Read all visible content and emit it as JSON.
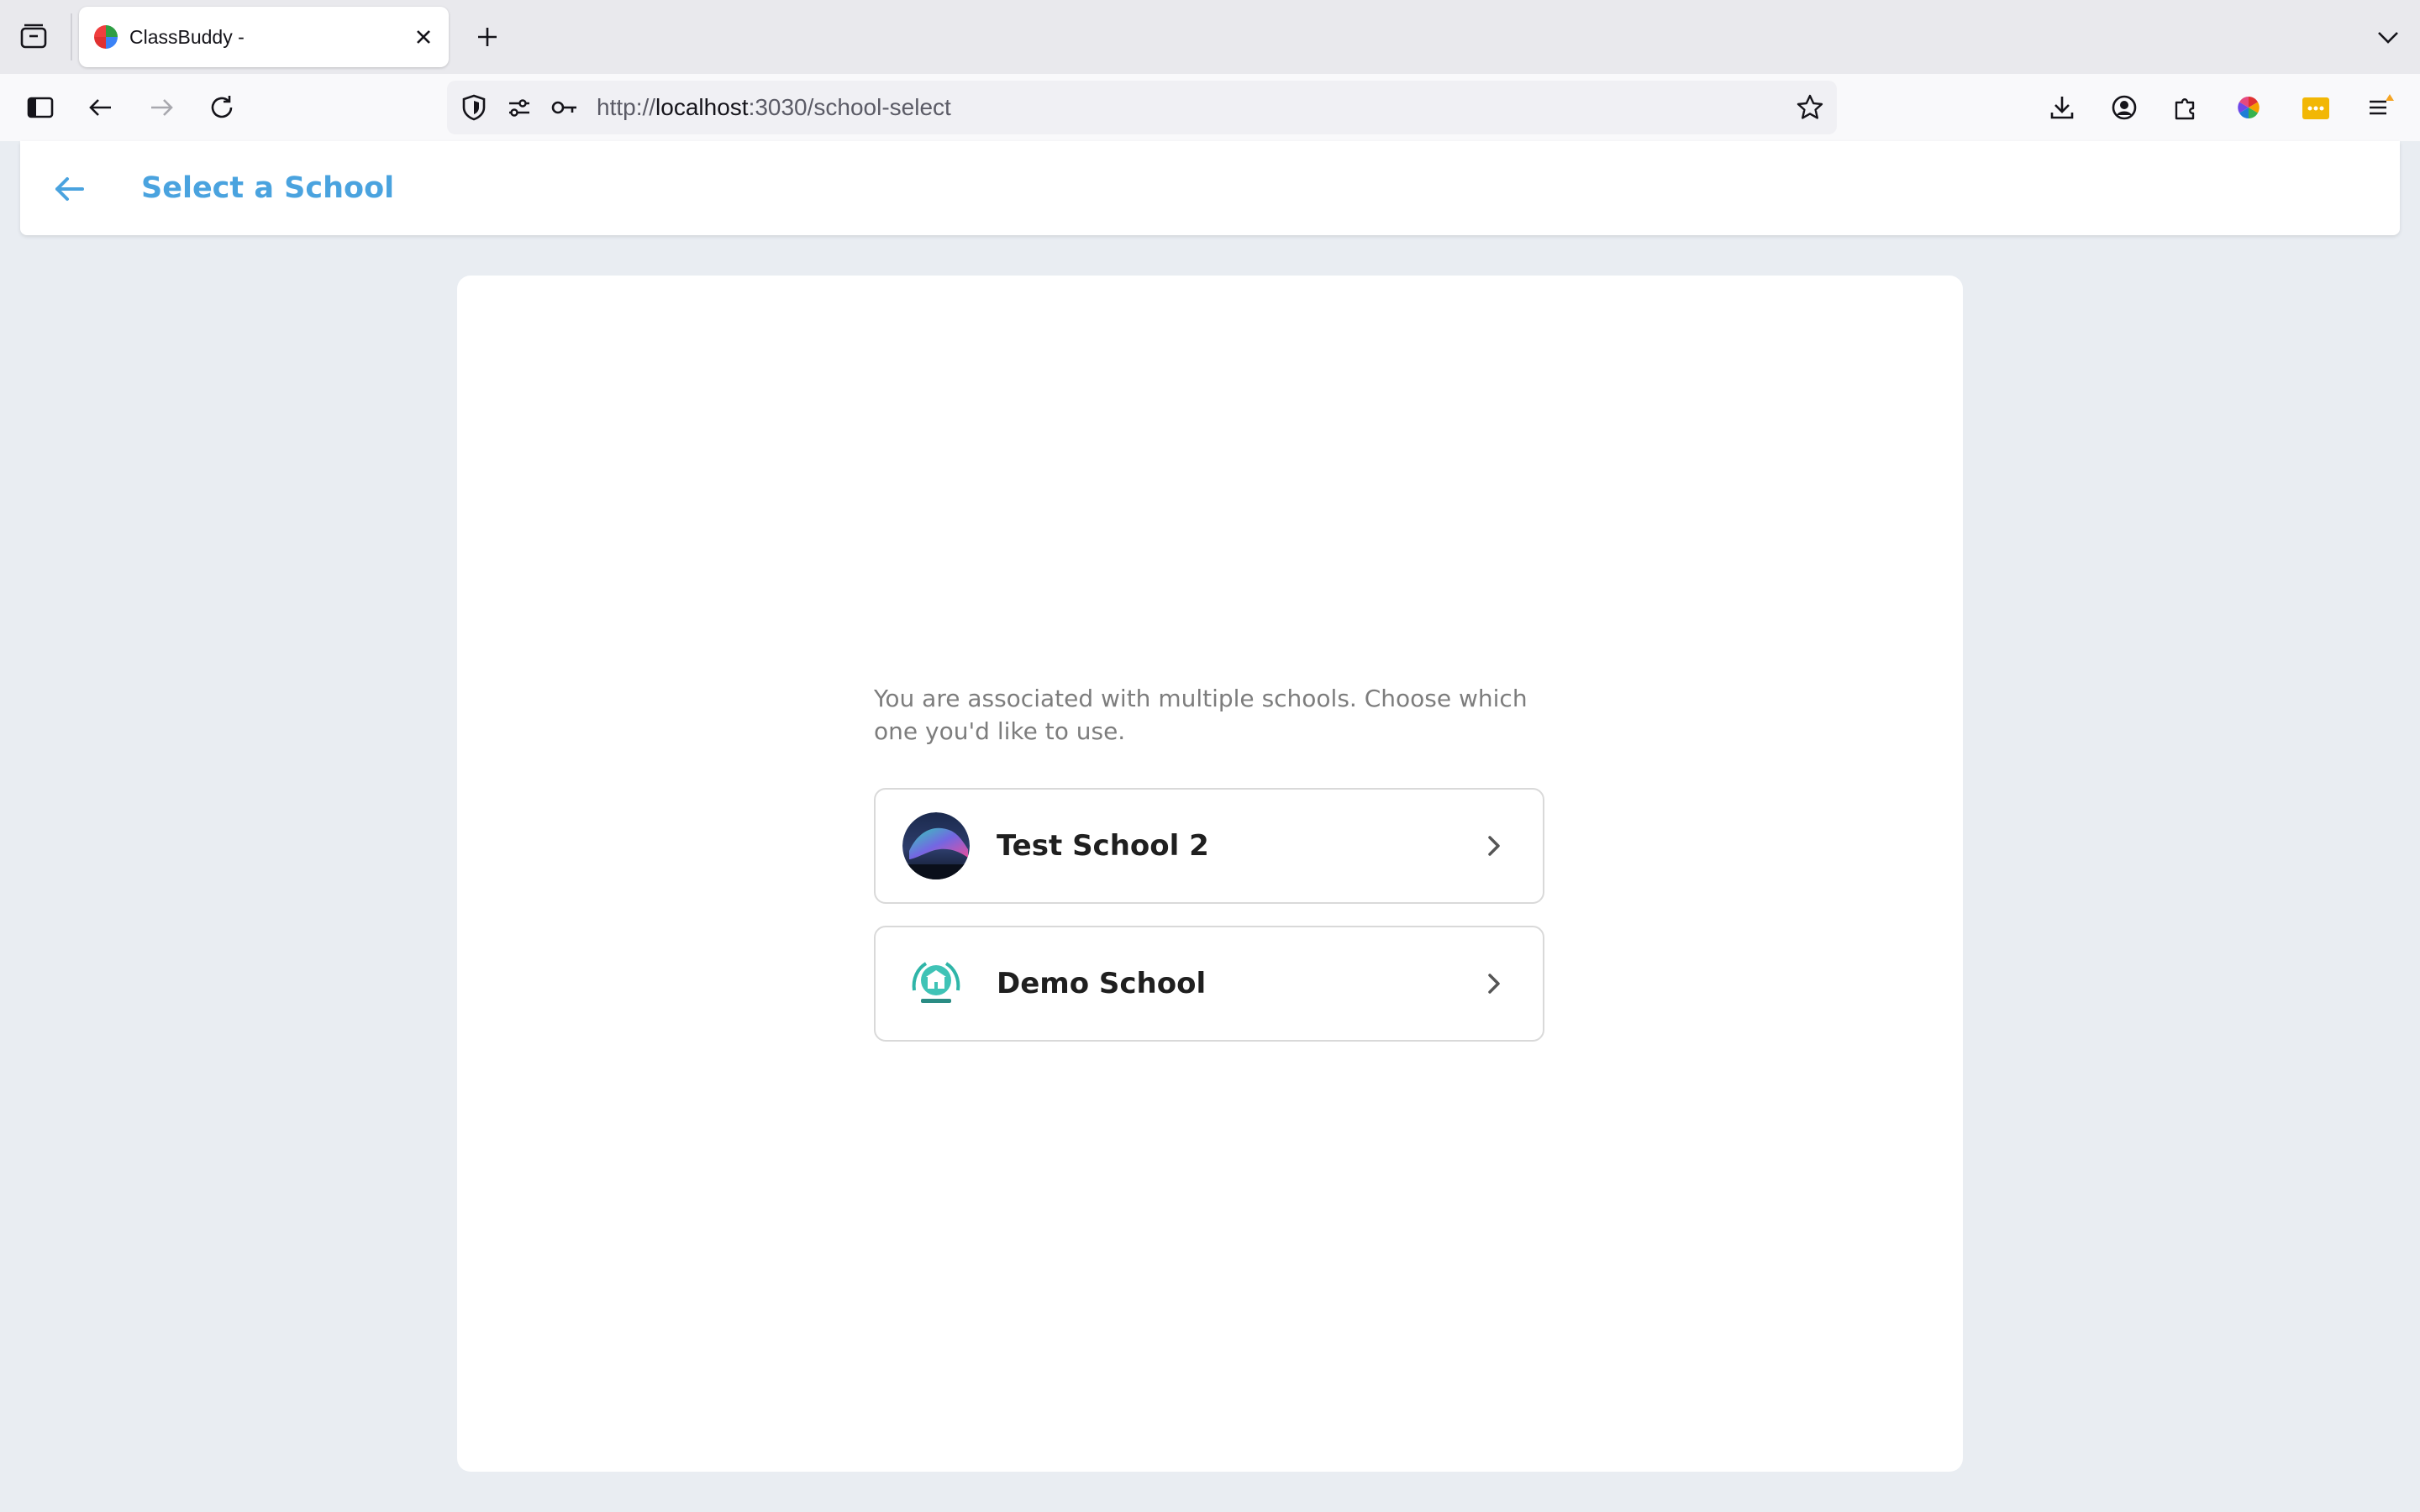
{
  "browser": {
    "tab_title": "ClassBuddy -",
    "url_scheme": "http://",
    "url_host": "localhost",
    "url_rest": ":3030/school-select"
  },
  "header": {
    "title": "Select a School"
  },
  "main": {
    "intro": "You are associated with multiple schools. Choose which one you'd like to use.",
    "schools": [
      {
        "name": "Test School 2",
        "avatar": "aurora-image"
      },
      {
        "name": "Demo School",
        "avatar": "school-emblem-image"
      }
    ]
  },
  "colors": {
    "accent": "#4aa3df",
    "page_bg": "#e9edf2"
  }
}
